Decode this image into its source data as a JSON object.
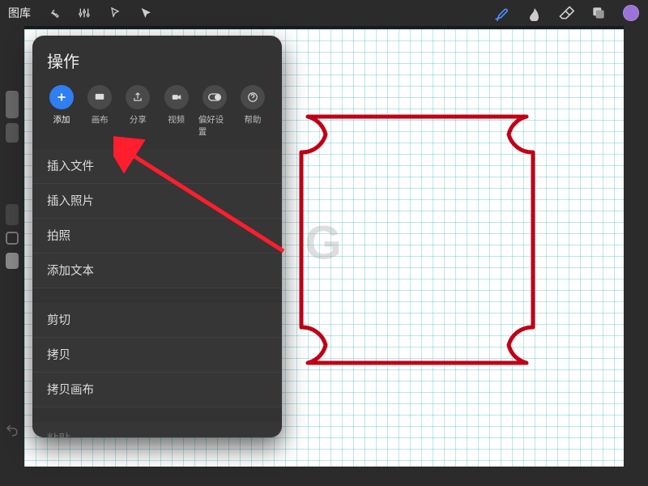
{
  "topbar": {
    "gallery_label": "图库"
  },
  "panel": {
    "title": "操作",
    "tabs": [
      {
        "label": "添加",
        "icon": "plus"
      },
      {
        "label": "画布",
        "icon": "canvas"
      },
      {
        "label": "分享",
        "icon": "share"
      },
      {
        "label": "视频",
        "icon": "video"
      },
      {
        "label": "偏好设置",
        "icon": "prefs"
      },
      {
        "label": "帮助",
        "icon": "help"
      }
    ],
    "items_group1": [
      "插入文件",
      "插入照片",
      "拍照",
      "添加文本"
    ],
    "items_group2": [
      "剪切",
      "拷贝",
      "拷贝画布"
    ],
    "items_group3": [
      "粘贴"
    ]
  },
  "colors": {
    "accent": "#2f7ff2",
    "swatch": "#9b72d8",
    "shape_stroke": "#c00016"
  },
  "watermark": "G"
}
